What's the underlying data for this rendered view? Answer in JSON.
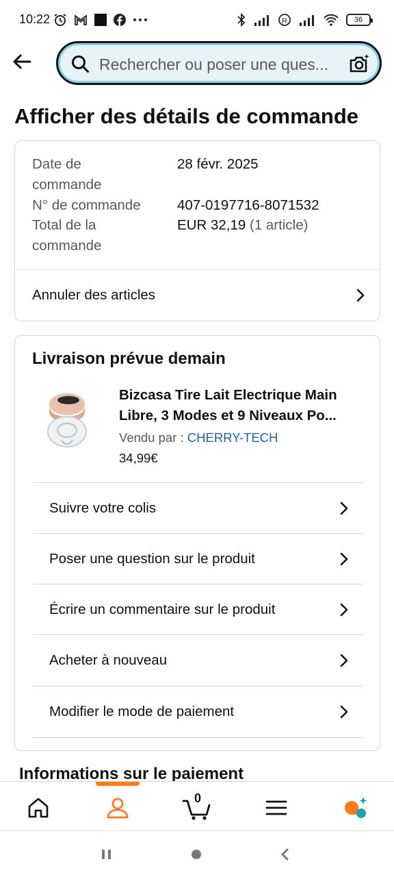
{
  "status_bar": {
    "time": "10:22",
    "battery": "36"
  },
  "search": {
    "placeholder": "Rechercher ou poser une ques..."
  },
  "page": {
    "title": "Afficher des détails de commande"
  },
  "order_summary": {
    "date_label": "Date de commande",
    "date_label_lines": [
      "Date de",
      "commande"
    ],
    "date_value": "28 févr. 2025",
    "number_label": "N° de commande",
    "number_value": "407-0197716-8071532",
    "total_label_lines": [
      "Total de la",
      "commande"
    ],
    "total_value": "EUR 32,19",
    "total_items": "(1 article)",
    "cancel_label": "Annuler des articles"
  },
  "delivery": {
    "title": "Livraison prévue demain",
    "product_title_lines": [
      "Bizcasa Tire Lait Electrique Main",
      "Libre, 3 Modes et 9 Niveaux Po..."
    ],
    "sold_by_label": "Vendu par  : ",
    "seller": "CHERRY-TECH",
    "price": "34,99€",
    "actions": [
      {
        "label": "Suivre votre colis"
      },
      {
        "label": "Poser une question sur le produit"
      },
      {
        "label": "Écrire un commentaire sur le produit"
      },
      {
        "label": "Acheter à nouveau"
      },
      {
        "label": "Modifier le mode de paiement"
      }
    ]
  },
  "payment_section": {
    "title": "Informations sur le paiement"
  },
  "bottom_nav": {
    "cart_count": "0",
    "items": [
      "home-icon",
      "account-icon",
      "cart-icon",
      "menu-icon",
      "rufus-icon"
    ],
    "active_color": "#ff7a1a"
  },
  "colors": {
    "search_bg": "#e8f3f8",
    "search_glow": "#7fd3e8",
    "link": "#2162a1",
    "accent": "#ff7a1a"
  }
}
